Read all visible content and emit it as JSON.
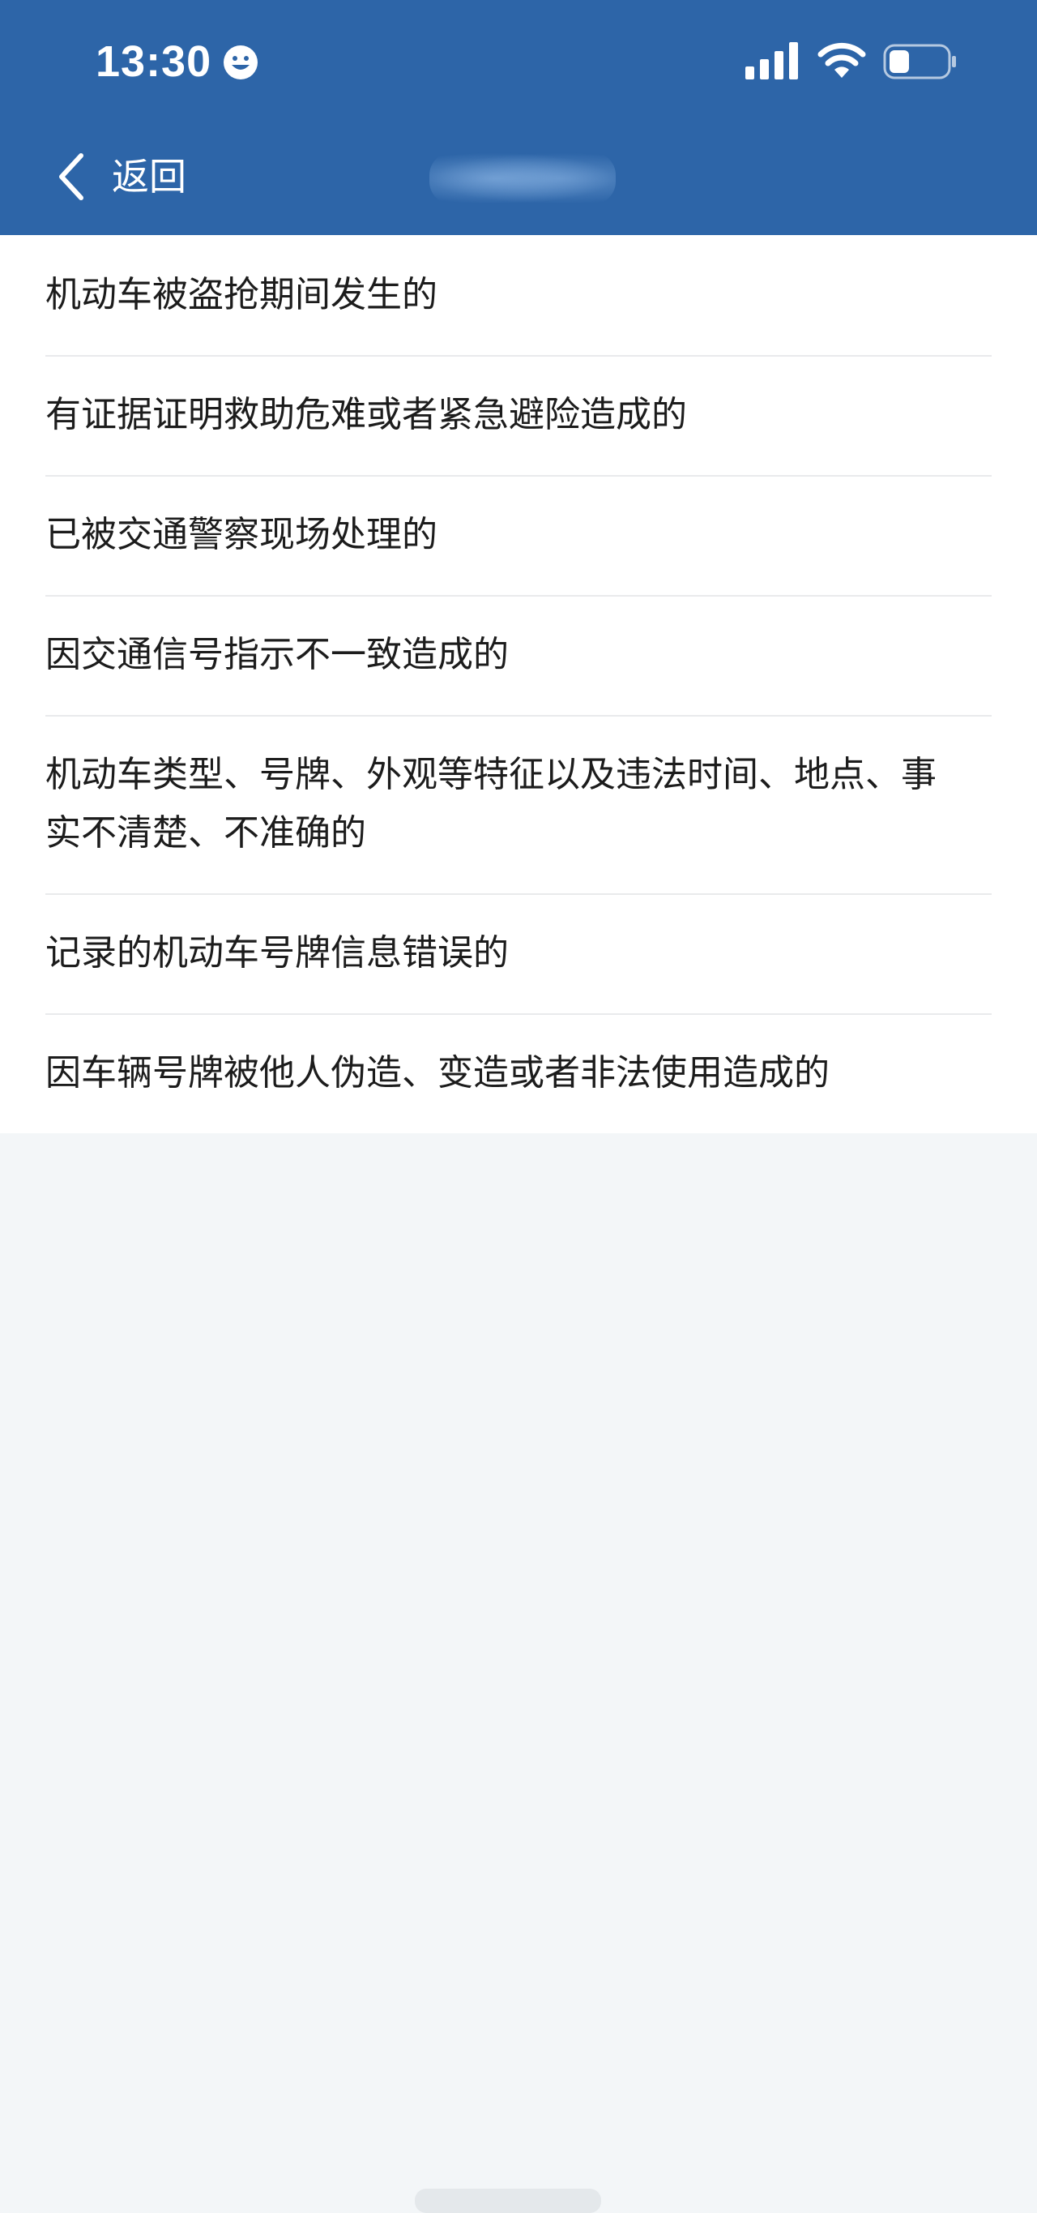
{
  "status_bar": {
    "time": "13:30",
    "emoji_icon": "smiley-face-icon",
    "signal_icon": "cellular-signal-icon",
    "wifi_icon": "wifi-icon",
    "battery_icon": "battery-icon",
    "battery_level": 0.35
  },
  "nav": {
    "back_icon": "chevron-left-icon",
    "back_label": "返回"
  },
  "list": {
    "items": [
      {
        "label": "机动车被盗抢期间发生的"
      },
      {
        "label": "有证据证明救助危难或者紧急避险造成的"
      },
      {
        "label": "已被交通警察现场处理的"
      },
      {
        "label": "因交通信号指示不一致造成的"
      },
      {
        "label": "机动车类型、号牌、外观等特征以及违法时间、地点、事实不清楚、不准确的"
      },
      {
        "label": "记录的机动车号牌信息错误的"
      },
      {
        "label": "因车辆号牌被他人伪造、变造或者非法使用造成的"
      }
    ]
  },
  "colors": {
    "header_bg": "#2d65a8",
    "page_bg": "#f3f6f8",
    "list_bg": "#ffffff",
    "text": "#1c1c1c",
    "divider": "#e9eaec"
  }
}
